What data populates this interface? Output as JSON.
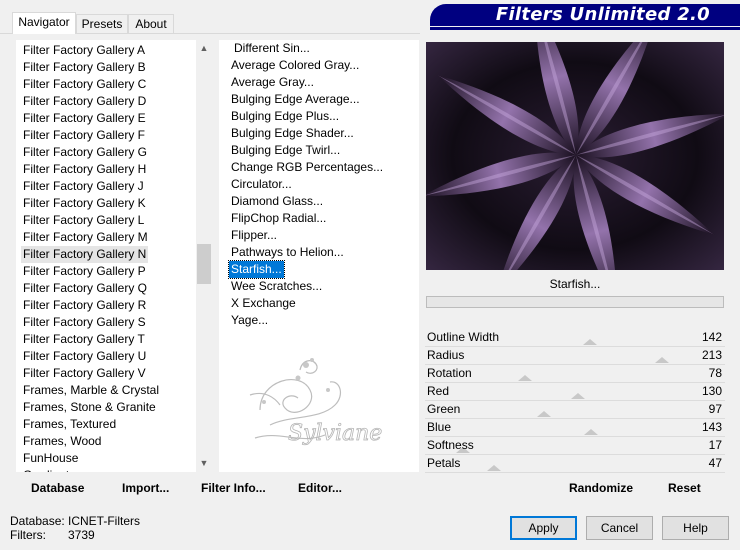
{
  "tabs": [
    {
      "label": "Navigator",
      "active": true
    },
    {
      "label": "Presets",
      "active": false
    },
    {
      "label": "About",
      "active": false
    }
  ],
  "banner": {
    "title": "Filters Unlimited 2.0",
    "color": "#000080"
  },
  "categories": {
    "items": [
      "Filter Factory Gallery A",
      "Filter Factory Gallery B",
      "Filter Factory Gallery C",
      "Filter Factory Gallery D",
      "Filter Factory Gallery E",
      "Filter Factory Gallery F",
      "Filter Factory Gallery G",
      "Filter Factory Gallery H",
      "Filter Factory Gallery J",
      "Filter Factory Gallery K",
      "Filter Factory Gallery L",
      "Filter Factory Gallery M",
      "Filter Factory Gallery N",
      "Filter Factory Gallery P",
      "Filter Factory Gallery Q",
      "Filter Factory Gallery R",
      "Filter Factory Gallery S",
      "Filter Factory Gallery T",
      "Filter Factory Gallery U",
      "Filter Factory Gallery V",
      "Frames, Marble & Crystal",
      "Frames, Stone & Granite",
      "Frames, Textured",
      "Frames, Wood",
      "FunHouse",
      "Gradient"
    ],
    "selected_index": 12
  },
  "filters": {
    "items": [
      "Different Sin...",
      "Average Colored Gray...",
      "Average Gray...",
      "Bulging Edge Average...",
      "Bulging Edge Plus...",
      "Bulging Edge Shader...",
      "Bulging Edge Twirl...",
      "Change RGB Percentages...",
      "Circulator...",
      "Diamond Glass...",
      "FlipChop Radial...",
      "Flipper...",
      "Pathways to Helion...",
      "Starfish...",
      "Wee Scratches...",
      "X Exchange",
      "Yage..."
    ],
    "selected_index": 13
  },
  "watermark": {
    "text": "Sylviane"
  },
  "preview": {
    "filter_name": "Starfish...",
    "accent": "#7a5a90"
  },
  "params": [
    {
      "label": "Outline Width",
      "value": "142",
      "level": 142
    },
    {
      "label": "Radius",
      "value": "213",
      "level": 213
    },
    {
      "label": "Rotation",
      "value": "78",
      "level": 78
    },
    {
      "label": "Red",
      "value": "130",
      "level": 130
    },
    {
      "label": "Green",
      "value": "97",
      "level": 97
    },
    {
      "label": "Blue",
      "value": "143",
      "level": 143
    },
    {
      "label": "Softness",
      "value": "17",
      "level": 17
    },
    {
      "label": "Petals",
      "value": "47",
      "level": 47
    }
  ],
  "buttons": {
    "database": "Database",
    "import": "Import...",
    "filter_info": "Filter Info...",
    "editor": "Editor...",
    "randomize": "Randomize",
    "reset": "Reset",
    "apply": "Apply",
    "cancel": "Cancel",
    "help": "Help"
  },
  "status": {
    "database_label": "Database:",
    "database_value": "ICNET-Filters",
    "filters_label": "Filters:",
    "filters_value": "3739"
  }
}
